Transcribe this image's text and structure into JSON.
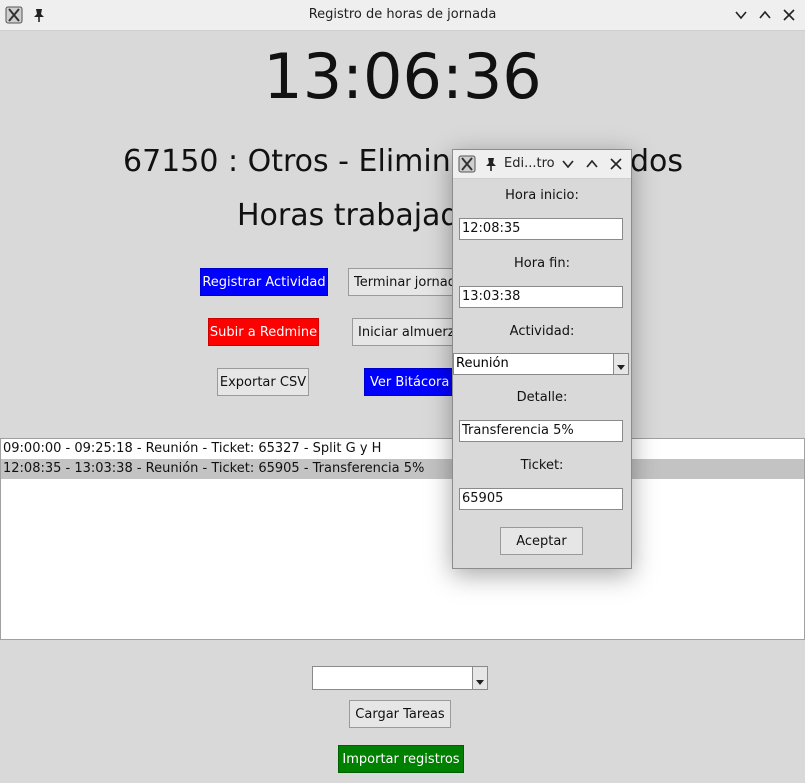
{
  "window": {
    "title": "Registro de horas de jornada"
  },
  "clock": "13:06:36",
  "current_task": "67150 : Otros - Elimina",
  "current_task_tail": "dos",
  "hours_label": "Horas trabajad",
  "buttons": {
    "registrar": "Registrar Actividad",
    "terminar": "Terminar jornad",
    "subir": "Subir a Redmine",
    "almuerzo": "Iniciar almuerz",
    "exportar": "Exportar CSV",
    "bitacora": "Ver Bitácora",
    "cargar": "Cargar Tareas",
    "importar": "Importar registros"
  },
  "records": [
    "09:00:00 - 09:25:18 - Reunión - Ticket: 65327 - Split G y H",
    "12:08:35 - 13:03:38 - Reunión - Ticket: 65905 - Transferencia 5%"
  ],
  "bottom_combo": {
    "value": ""
  },
  "dialog": {
    "title": "Edi...tro",
    "hora_inicio_label": "Hora inicio:",
    "hora_inicio_value": "12:08:35",
    "hora_fin_label": "Hora fin:",
    "hora_fin_value": "13:03:38",
    "actividad_label": "Actividad:",
    "actividad_value": "Reunión",
    "detalle_label": "Detalle:",
    "detalle_value": "Transferencia 5%",
    "ticket_label": "Ticket:",
    "ticket_value": "65905",
    "aceptar": "Aceptar"
  },
  "colors": {
    "blue_button": "#0000ff",
    "red_button": "#ff0000",
    "green_button": "#008000",
    "background": "#d9d9d9"
  }
}
